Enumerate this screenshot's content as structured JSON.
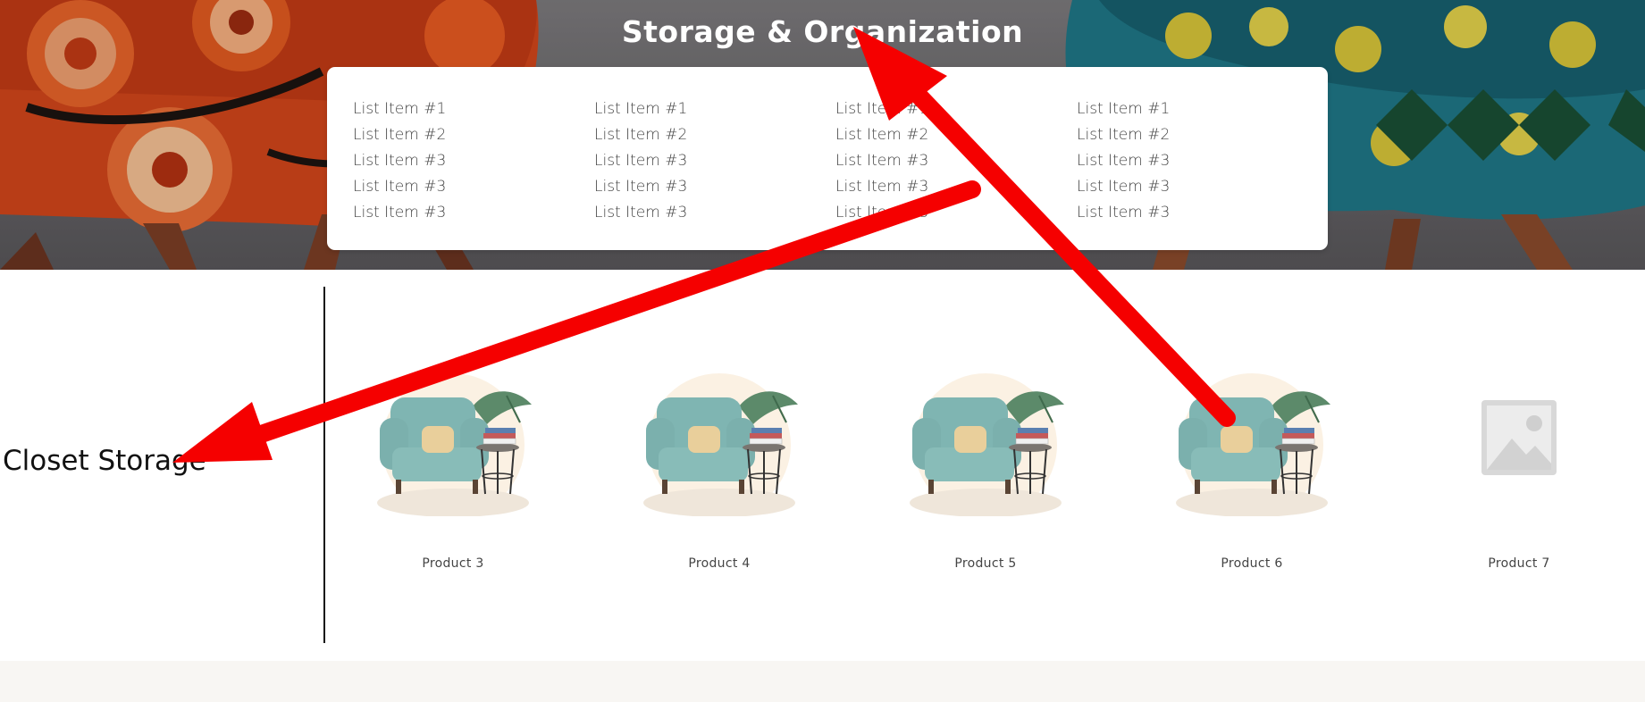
{
  "hero": {
    "title": "Storage & Organization",
    "menu": {
      "columns": [
        [
          "List Item #1",
          "List Item #2",
          "List Item #3",
          "List Item #3",
          "List Item #3"
        ],
        [
          "List Item #1",
          "List Item #2",
          "List Item #3",
          "List Item #3",
          "List Item #3"
        ],
        [
          "List Item #1",
          "List Item #2",
          "List Item #3",
          "List Item #3",
          "List Item #3"
        ],
        [
          "List Item #1",
          "List Item #2",
          "List Item #3",
          "List Item #3",
          "List Item #3"
        ]
      ]
    }
  },
  "section": {
    "title": "Closet Storage",
    "products": [
      {
        "name": "Product 3",
        "image": "armchair"
      },
      {
        "name": "Product 4",
        "image": "armchair"
      },
      {
        "name": "Product 5",
        "image": "armchair"
      },
      {
        "name": "Product 6",
        "image": "armchair"
      },
      {
        "name": "Product 7",
        "image": "placeholder"
      }
    ]
  },
  "annotation": {
    "arrow_color": "#ff0000",
    "count": 2
  },
  "colors": {
    "accent_card": "#ffffff",
    "footer_band": "#f8f6f3"
  }
}
